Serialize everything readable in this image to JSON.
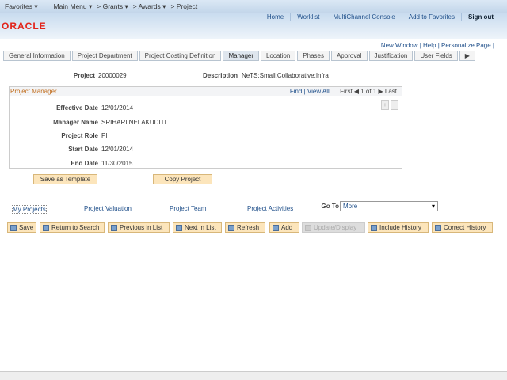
{
  "nav": {
    "items": [
      "Favorites ▾",
      "Main Menu ▾",
      "> Grants ▾",
      "> Awards ▾",
      "> Project"
    ]
  },
  "header": {
    "logo": "ORACLE",
    "links": [
      "Home",
      "Worklist",
      "MultiChannel Console",
      "Add to Favorites",
      "Sign out"
    ]
  },
  "pagelinks": "New Window | Help | Personalize Page |",
  "tabs": [
    "General Information",
    "Project Department",
    "Project Costing Definition",
    "Manager",
    "Location",
    "Phases",
    "Approval",
    "Justification",
    "User Fields"
  ],
  "project": {
    "label": "Project",
    "value": "20000029",
    "desc_label": "Description",
    "desc": "NeTS:Small:Collaborative:Infra"
  },
  "box": {
    "title": "Project Manager",
    "find": "Find | View All",
    "nav": "First ◀ 1 of 1 ▶ Last",
    "fields": [
      {
        "label": "Effective Date",
        "value": "12/01/2014"
      },
      {
        "label": "Manager Name",
        "value": "SRIHARI NELAKUDITI"
      },
      {
        "label": "Project Role",
        "value": "PI"
      },
      {
        "label": "Start Date",
        "value": "12/01/2014"
      },
      {
        "label": "End Date",
        "value": "11/30/2015"
      }
    ]
  },
  "buttons": {
    "template": "Save as Template",
    "copy": "Copy Project"
  },
  "links": [
    "My Projects",
    "Project Valuation",
    "Project Team",
    "Project Activities"
  ],
  "goto": {
    "label": "Go To",
    "value": "More"
  },
  "toolbar": [
    "Save",
    "Return to Search",
    "Previous in List",
    "Next in List",
    "Refresh",
    "Add",
    "Update/Display",
    "Include History",
    "Correct History"
  ]
}
